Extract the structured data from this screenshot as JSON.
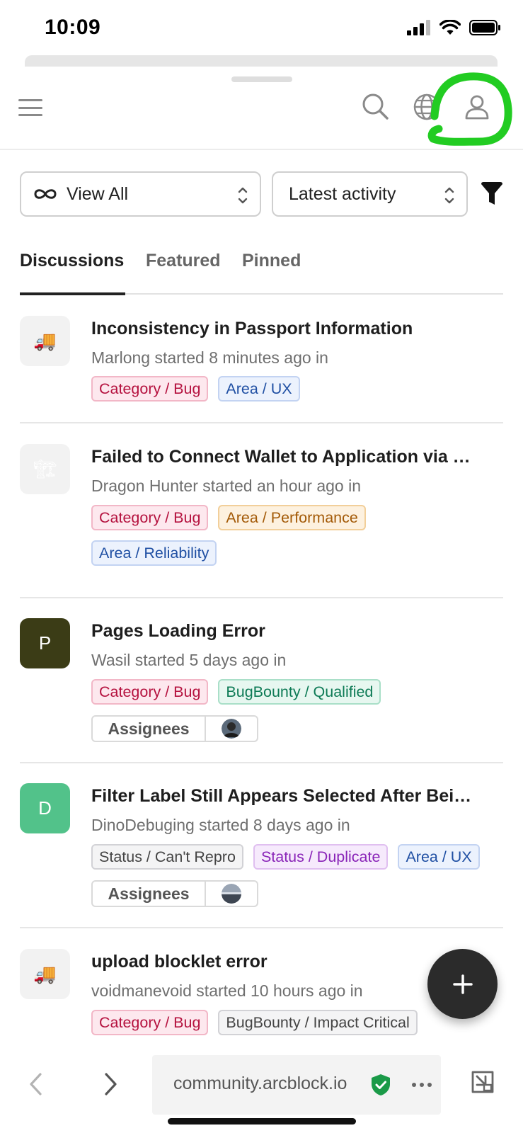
{
  "status_bar": {
    "time": "10:09"
  },
  "header": {
    "menu_icon": "hamburger-menu-icon",
    "search_icon": "search-icon",
    "language_icon": "globe-icon",
    "profile_icon": "user-icon",
    "annotation_color": "#22cc22"
  },
  "filters": {
    "view": {
      "label": "View All",
      "icon": "infinity-icon"
    },
    "sort": {
      "label": "Latest activity"
    },
    "filter_icon": "funnel-icon"
  },
  "tabs": [
    {
      "label": "Discussions",
      "active": true
    },
    {
      "label": "Featured",
      "active": false
    },
    {
      "label": "Pinned",
      "active": false
    }
  ],
  "discussions": [
    {
      "title": "Inconsistency in Passport Information",
      "meta": "Marlong started 8 minutes ago in",
      "avatar": {
        "type": "emoji",
        "glyph": "🚚"
      },
      "tags": [
        {
          "label": "Category / Bug",
          "color": "red"
        },
        {
          "label": "Area / UX",
          "color": "blue"
        }
      ]
    },
    {
      "title": "Failed to Connect Wallet to Application via …",
      "meta": "Dragon Hunter started an hour ago in",
      "avatar": {
        "type": "emoji",
        "glyph": "🏗"
      },
      "tags": [
        {
          "label": "Category / Bug",
          "color": "red"
        },
        {
          "label": "Area / Performance",
          "color": "orange"
        },
        {
          "label": "Area / Reliability",
          "color": "blue"
        }
      ]
    },
    {
      "title": "Pages Loading Error",
      "meta": "Wasil started 5 days ago in",
      "avatar": {
        "type": "letter",
        "glyph": "P",
        "color": "#3b3c16"
      },
      "tags": [
        {
          "label": "Category / Bug",
          "color": "red"
        },
        {
          "label": "BugBounty / Qualified",
          "color": "green"
        }
      ],
      "assignees_label": "Assignees"
    },
    {
      "title": "Filter Label Still Appears Selected After Bei…",
      "meta": "DinoDebuging started 8 days ago in",
      "avatar": {
        "type": "letter",
        "glyph": "D",
        "color": "#52c28a"
      },
      "tags": [
        {
          "label": "Status / Can't Repro",
          "color": "gray"
        },
        {
          "label": "Status / Duplicate",
          "color": "purple"
        },
        {
          "label": "Area / UX",
          "color": "blue"
        }
      ],
      "assignees_label": "Assignees"
    },
    {
      "title": "upload blocklet error",
      "meta": "voidmanevoid started 10 hours ago in",
      "avatar": {
        "type": "emoji",
        "glyph": "🚚"
      },
      "tags": [
        {
          "label": "Category / Bug",
          "color": "red"
        },
        {
          "label": "BugBounty / Impact Critical",
          "color": "gray"
        }
      ]
    }
  ],
  "fab": {
    "icon": "plus-icon"
  },
  "browser": {
    "url": "community.arcblock.io",
    "secure_icon": "shield-check-icon",
    "back_icon": "chevron-left-icon",
    "forward_icon": "chevron-right-icon",
    "more_icon": "more-dots-icon",
    "tabs_icon": "minimize-window-icon"
  }
}
